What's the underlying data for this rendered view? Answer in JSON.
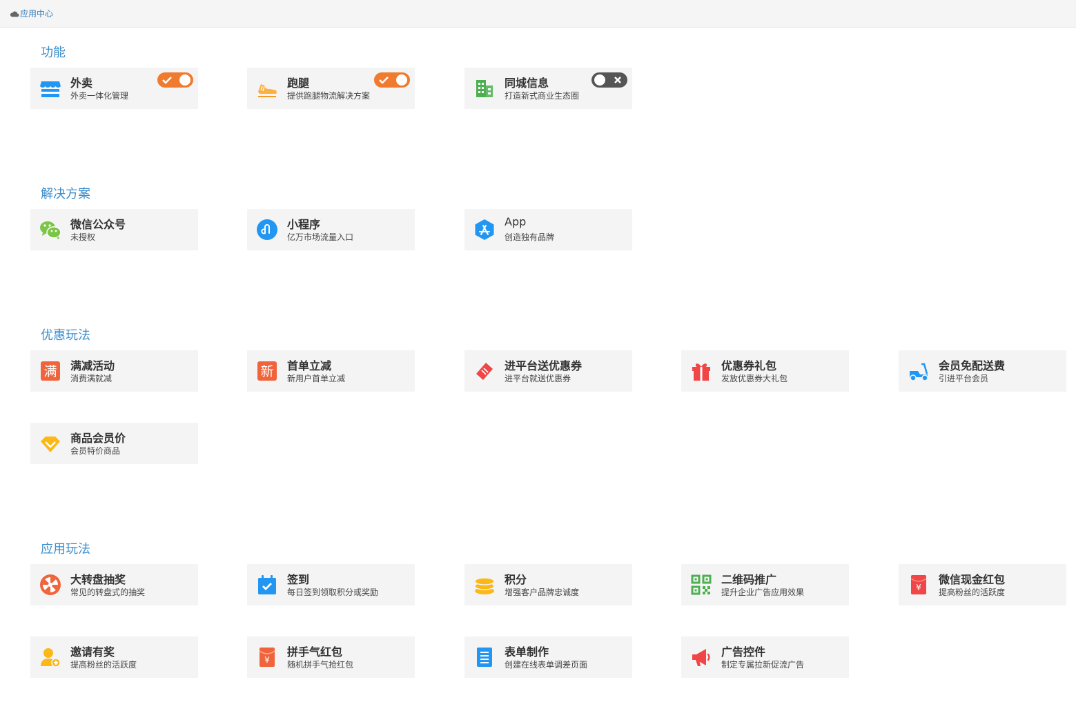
{
  "breadcrumb": "应用中心",
  "sections": [
    {
      "title": "功能",
      "items": [
        {
          "title": "外卖",
          "desc": "外卖一体化管理",
          "icon": "store-icon",
          "toggle": "on"
        },
        {
          "title": "跑腿",
          "desc": "提供跑腿物流解决方案",
          "icon": "shoe-icon",
          "toggle": "on"
        },
        {
          "title": "同城信息",
          "desc": "打造新式商业生态圈",
          "icon": "building-icon",
          "toggle": "off"
        }
      ]
    },
    {
      "title": "解决方案",
      "items": [
        {
          "title": "微信公众号",
          "desc": "未授权",
          "icon": "wechat-icon"
        },
        {
          "title": "小程序",
          "desc": "亿万市场流量入口",
          "icon": "miniprogram-icon"
        },
        {
          "title": "App",
          "desc": "创造独有品牌",
          "icon": "appstore-icon"
        }
      ]
    },
    {
      "title": "优惠玩法",
      "items": [
        {
          "title": "满减活动",
          "desc": "消费满就减",
          "icon": "full-reduction-icon"
        },
        {
          "title": "首单立减",
          "desc": "新用户首单立减",
          "icon": "new-user-icon"
        },
        {
          "title": "进平台送优惠券",
          "desc": "进平台就送优惠券",
          "icon": "coupon-ticket-icon"
        },
        {
          "title": "优惠券礼包",
          "desc": "发放优惠券大礼包",
          "icon": "gift-icon"
        },
        {
          "title": "会员免配送费",
          "desc": "引进平台会员",
          "icon": "scooter-icon"
        },
        {
          "title": "商品会员价",
          "desc": "会员特价商品",
          "icon": "diamond-icon"
        }
      ]
    },
    {
      "title": "应用玩法",
      "items": [
        {
          "title": "大转盘抽奖",
          "desc": "常见的转盘式的抽奖",
          "icon": "wheel-icon"
        },
        {
          "title": "签到",
          "desc": "每日签到领取积分或奖励",
          "icon": "calendar-check-icon"
        },
        {
          "title": "积分",
          "desc": "增强客户品牌忠诚度",
          "icon": "coins-icon"
        },
        {
          "title": "二维码推广",
          "desc": "提升企业广告应用效果",
          "icon": "qrcode-icon"
        },
        {
          "title": "微信现金红包",
          "desc": "提高粉丝的活跃度",
          "icon": "red-envelope-icon"
        },
        {
          "title": "邀请有奖",
          "desc": "提高粉丝的活跃度",
          "icon": "invite-user-icon"
        },
        {
          "title": "拼手气红包",
          "desc": "随机拼手气抢红包",
          "icon": "lucky-envelope-icon"
        },
        {
          "title": "表单制作",
          "desc": "创建在线表单调差页面",
          "icon": "form-icon"
        },
        {
          "title": "广告控件",
          "desc": "制定专属拉新促流广告",
          "icon": "megaphone-icon"
        }
      ]
    }
  ],
  "colors": {
    "accent_title": "#3c8dcc",
    "toggle_on": "#f07a2e",
    "toggle_off": "#555555",
    "card_bg": "#f4f4f4"
  }
}
